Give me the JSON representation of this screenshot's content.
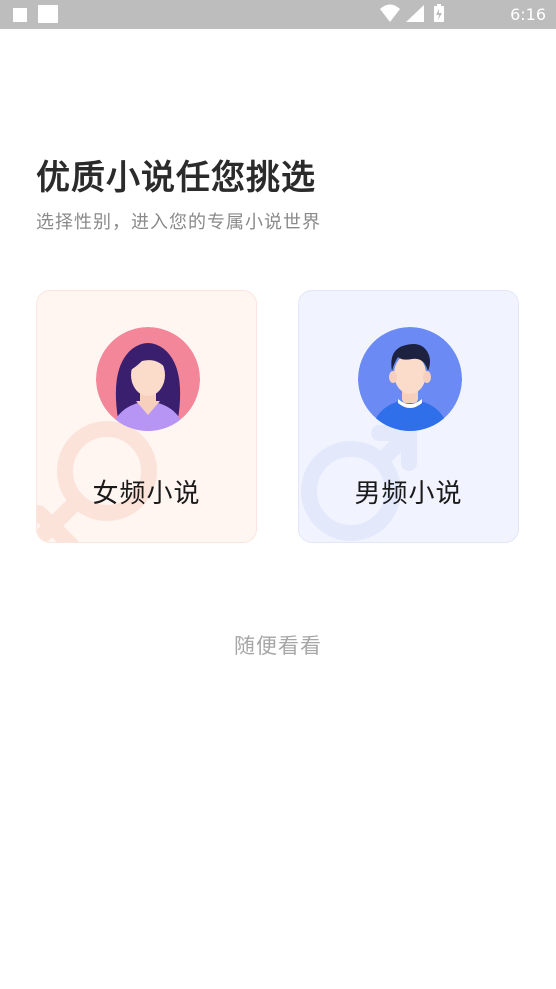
{
  "status_bar": {
    "time": "6:16",
    "icons": [
      "notification-square-icon",
      "notification-square-icon",
      "wifi-icon",
      "cellular-signal-icon",
      "battery-icon"
    ],
    "background_color": "#bdbdbd"
  },
  "header": {
    "title": "优质小说任您挑选",
    "subtitle": "选择性别，进入您的专属小说世界"
  },
  "gender_options": [
    {
      "label": "女频小说",
      "icon": "female-avatar-icon",
      "card_color": "#fff5f1",
      "avatar_color": "#f4869a"
    },
    {
      "label": "男频小说",
      "icon": "male-avatar-icon",
      "card_color": "#f1f4ff",
      "avatar_color": "#6b8af4"
    }
  ],
  "browse_link": {
    "label": "随便看看"
  }
}
